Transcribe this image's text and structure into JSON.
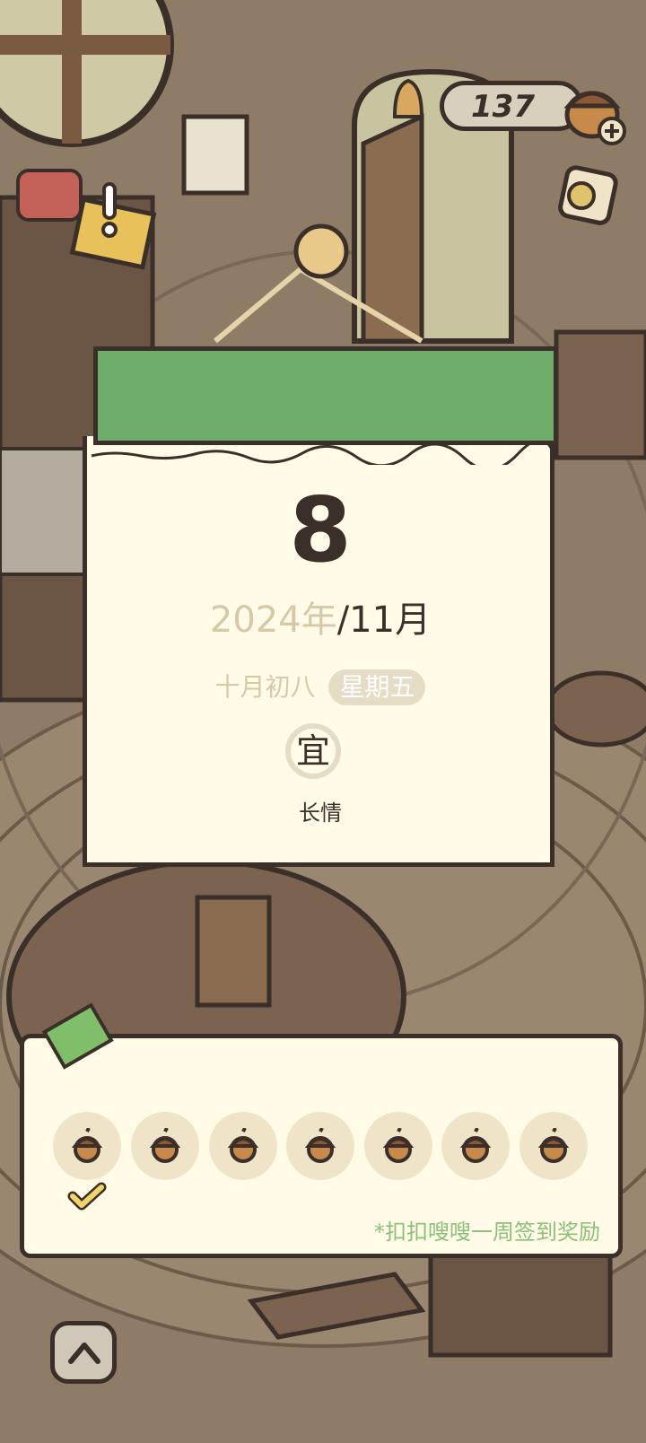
{
  "hud": {
    "acorn_count": "137"
  },
  "calendar": {
    "day": "8",
    "year": "2024年",
    "month": "/11月",
    "lunar_date": "十月初八",
    "weekday": "星期五",
    "yi_label": "宜",
    "yi_activity": "长情"
  },
  "weekly_reward": {
    "slots": [
      "acorn-icon",
      "acorn-icon",
      "acorn-icon",
      "acorn-icon",
      "acorn-icon",
      "acorn-icon",
      "acorn-icon"
    ],
    "checked_count": 1,
    "caption": "*扣扣嗖嗖一周签到奖励"
  },
  "colors": {
    "header_green": "#6fad6a",
    "paper": "#fffbe6",
    "caption_green": "#8cc07a",
    "ink": "#3b2f2a"
  }
}
